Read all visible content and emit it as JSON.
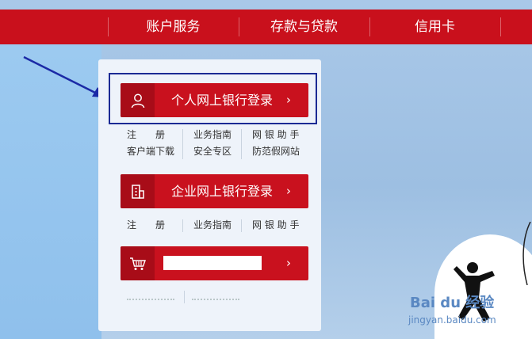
{
  "nav": {
    "items": [
      "账户服务",
      "存款与贷款",
      "信用卡"
    ]
  },
  "personal": {
    "button_label": "个人网上银行登录",
    "chevron": "›",
    "links": [
      "注　　册",
      "业务指南",
      "网 银 助 手",
      "客户端下载",
      "安全专区",
      "防范假网站"
    ]
  },
  "corporate": {
    "button_label": "企业网上银行登录",
    "chevron": "›",
    "links": [
      "注　　册",
      "业务指南",
      "网 银 助 手"
    ]
  },
  "mall": {
    "chevron": "›"
  },
  "watermark": {
    "main": "Bai du 经验",
    "sub": "jingyan.baidu.com"
  },
  "colors": {
    "brand_red": "#c9101c",
    "highlight_border": "#1b2a94",
    "arrow": "#1b2aa6"
  },
  "icons": {
    "personal": "user-icon",
    "corporate": "building-icon",
    "mall": "shopping-cart-icon"
  }
}
